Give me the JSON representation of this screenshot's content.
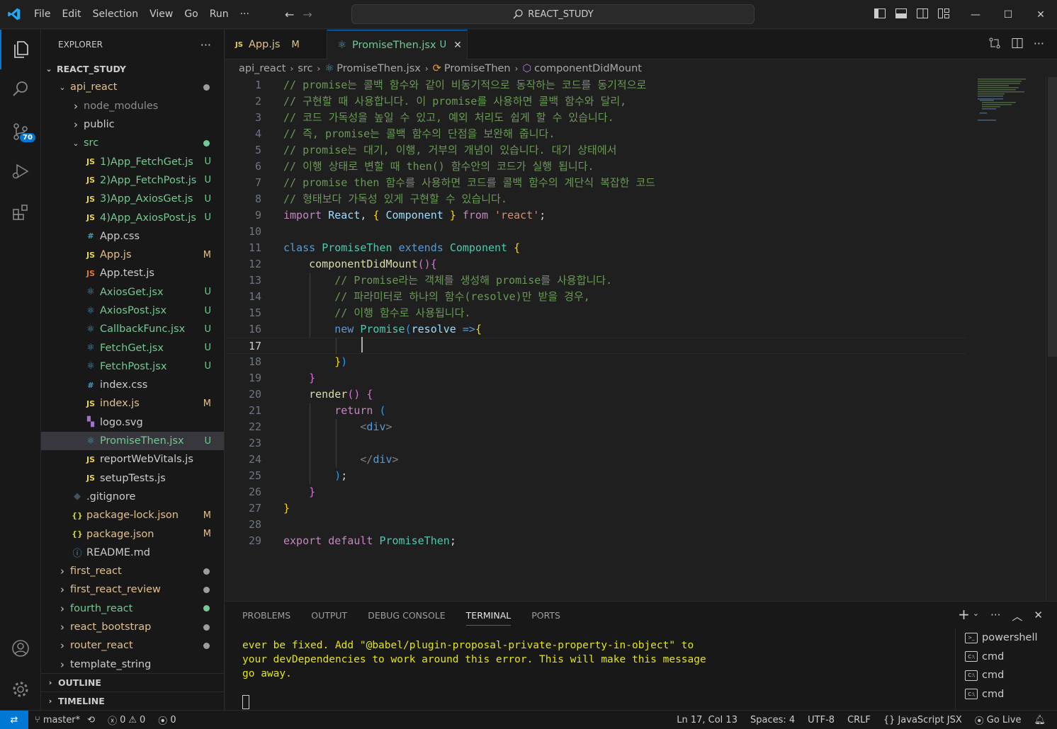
{
  "titlebar": {
    "menu": [
      "File",
      "Edit",
      "Selection",
      "View",
      "Go",
      "Run",
      "···"
    ],
    "search_text": "REACT_STUDY"
  },
  "activitybar": {
    "source_control_badge": "70"
  },
  "explorer": {
    "title": "EXPLORER",
    "more": "···",
    "root": "REACT_STUDY",
    "items": [
      {
        "label": "api_react",
        "indent": 1,
        "type": "folder-open",
        "color": "#e2c08d",
        "dot": "#9d9d9d"
      },
      {
        "label": "node_modules",
        "indent": 2,
        "type": "folder",
        "color": "#8c8c8c"
      },
      {
        "label": "public",
        "indent": 2,
        "type": "folder",
        "color": "#cccccc"
      },
      {
        "label": "src",
        "indent": 2,
        "type": "folder-open",
        "color": "#73c991",
        "dot": "#73c991"
      },
      {
        "label": "1)App_FetchGet.js",
        "indent": 3,
        "icon": "JS",
        "icon_color": "#e8d44d",
        "color": "#73c991",
        "status": "U"
      },
      {
        "label": "2)App_FetchPost.js",
        "indent": 3,
        "icon": "JS",
        "icon_color": "#e8d44d",
        "color": "#73c991",
        "status": "U"
      },
      {
        "label": "3)App_AxiosGet.js",
        "indent": 3,
        "icon": "JS",
        "icon_color": "#e8d44d",
        "color": "#73c991",
        "status": "U"
      },
      {
        "label": "4)App_AxiosPost.js",
        "indent": 3,
        "icon": "JS",
        "icon_color": "#e8d44d",
        "color": "#73c991",
        "status": "U"
      },
      {
        "label": "App.css",
        "indent": 3,
        "icon": "#",
        "icon_color": "#519aba",
        "color": "#cccccc"
      },
      {
        "label": "App.js",
        "indent": 3,
        "icon": "JS",
        "icon_color": "#e8d44d",
        "color": "#e2c08d",
        "status": "M"
      },
      {
        "label": "App.test.js",
        "indent": 3,
        "icon": "JS",
        "icon_color": "#e37933",
        "color": "#cccccc"
      },
      {
        "label": "AxiosGet.jsx",
        "indent": 3,
        "icon": "⚛",
        "icon_color": "#519aba",
        "color": "#73c991",
        "status": "U"
      },
      {
        "label": "AxiosPost.jsx",
        "indent": 3,
        "icon": "⚛",
        "icon_color": "#519aba",
        "color": "#73c991",
        "status": "U"
      },
      {
        "label": "CallbackFunc.jsx",
        "indent": 3,
        "icon": "⚛",
        "icon_color": "#519aba",
        "color": "#73c991",
        "status": "U"
      },
      {
        "label": "FetchGet.jsx",
        "indent": 3,
        "icon": "⚛",
        "icon_color": "#519aba",
        "color": "#73c991",
        "status": "U"
      },
      {
        "label": "FetchPost.jsx",
        "indent": 3,
        "icon": "⚛",
        "icon_color": "#519aba",
        "color": "#73c991",
        "status": "U"
      },
      {
        "label": "index.css",
        "indent": 3,
        "icon": "#",
        "icon_color": "#519aba",
        "color": "#cccccc"
      },
      {
        "label": "index.js",
        "indent": 3,
        "icon": "JS",
        "icon_color": "#e8d44d",
        "color": "#e2c08d",
        "status": "M"
      },
      {
        "label": "logo.svg",
        "indent": 3,
        "icon": "▚",
        "icon_color": "#a074c4",
        "color": "#cccccc"
      },
      {
        "label": "PromiseThen.jsx",
        "indent": 3,
        "icon": "⚛",
        "icon_color": "#519aba",
        "color": "#73c991",
        "status": "U",
        "selected": true
      },
      {
        "label": "reportWebVitals.js",
        "indent": 3,
        "icon": "JS",
        "icon_color": "#e8d44d",
        "color": "#cccccc"
      },
      {
        "label": "setupTests.js",
        "indent": 3,
        "icon": "JS",
        "icon_color": "#e8d44d",
        "color": "#cccccc"
      },
      {
        "label": ".gitignore",
        "indent": 2,
        "icon": "◆",
        "icon_color": "#41535b",
        "color": "#cccccc"
      },
      {
        "label": "package-lock.json",
        "indent": 2,
        "icon": "{}",
        "icon_color": "#cbcb41",
        "color": "#e2c08d",
        "status": "M"
      },
      {
        "label": "package.json",
        "indent": 2,
        "icon": "{}",
        "icon_color": "#cbcb41",
        "color": "#e2c08d",
        "status": "M"
      },
      {
        "label": "README.md",
        "indent": 2,
        "icon": "ⓘ",
        "icon_color": "#519aba",
        "color": "#cccccc"
      },
      {
        "label": "first_react",
        "indent": 1,
        "type": "folder",
        "color": "#e2c08d",
        "dot": "#9d9d9d"
      },
      {
        "label": "first_react_review",
        "indent": 1,
        "type": "folder",
        "color": "#e2c08d",
        "dot": "#9d9d9d"
      },
      {
        "label": "fourth_react",
        "indent": 1,
        "type": "folder",
        "color": "#73c991",
        "dot": "#73c991"
      },
      {
        "label": "react_bootstrap",
        "indent": 1,
        "type": "folder",
        "color": "#e2c08d",
        "dot": "#9d9d9d"
      },
      {
        "label": "router_react",
        "indent": 1,
        "type": "folder",
        "color": "#e2c08d",
        "dot": "#9d9d9d"
      },
      {
        "label": "template_string",
        "indent": 1,
        "type": "folder",
        "color": "#cccccc"
      }
    ],
    "outline": "OUTLINE",
    "timeline": "TIMELINE"
  },
  "tabs": [
    {
      "label": "App.js",
      "icon": "JS",
      "status": "M"
    },
    {
      "label": "PromiseThen.jsx",
      "icon": "⚛",
      "status": "U",
      "active": true
    }
  ],
  "breadcrumb": [
    "api_react",
    "src",
    "PromiseThen.jsx",
    "PromiseThen",
    "componentDidMount"
  ],
  "editor": {
    "current_line": 17,
    "lines": [
      [
        [
          "cm",
          "// promise는 콜백 함수와 같이 비동기적으로 동작하는 코드를 동기적으로"
        ]
      ],
      [
        [
          "cm",
          "// 구현할 때 사용합니다. 이 promise를 사용하면 콜백 함수와 달리,"
        ]
      ],
      [
        [
          "cm",
          "// 코드 가독성을 높일 수 있고, 예외 처리도 쉽게 할 수 있습니다."
        ]
      ],
      [
        [
          "cm",
          "// 즉, promise는 콜백 함수의 단점을 보완해 줍니다."
        ]
      ],
      [
        [
          "cm",
          "// promise는 대기, 이행, 거부의 개념이 있습니다. 대기 상태에서"
        ]
      ],
      [
        [
          "cm",
          "// 이행 상태로 변할 때 then() 함수안의 코드가 실행 됩니다."
        ]
      ],
      [
        [
          "cm",
          "// promise then 함수를 사용하면 코드를 콜백 함수의 계단식 복잡한 코드"
        ]
      ],
      [
        [
          "cm",
          "// 형태보다 가독성 있게 구현할 수 있습니다."
        ]
      ],
      [
        [
          "kw2",
          "import "
        ],
        [
          "var",
          "React"
        ],
        [
          "pl",
          ", "
        ],
        [
          "br1",
          "{ "
        ],
        [
          "var",
          "Component"
        ],
        [
          "br1",
          " }"
        ],
        [
          "kw2",
          " from "
        ],
        [
          "str",
          "'react'"
        ],
        [
          "pl",
          ";"
        ]
      ],
      [],
      [
        [
          "kw",
          "class "
        ],
        [
          "cls",
          "PromiseThen "
        ],
        [
          "kw",
          "extends "
        ],
        [
          "cls",
          "Component "
        ],
        [
          "br1",
          "{"
        ]
      ],
      [
        [
          "pl",
          "    "
        ],
        [
          "fn",
          "componentDidMount"
        ],
        [
          "br2",
          "(){"
        ]
      ],
      [
        [
          "pl",
          "        "
        ],
        [
          "cm",
          "// Promise라는 객체를 생성해 promise를 사용합니다."
        ]
      ],
      [
        [
          "pl",
          "        "
        ],
        [
          "cm",
          "// 파라미터로 하나의 함수(resolve)만 받을 경우,"
        ]
      ],
      [
        [
          "pl",
          "        "
        ],
        [
          "cm",
          "// 이행 함수로 사용됩니다."
        ]
      ],
      [
        [
          "pl",
          "        "
        ],
        [
          "kw",
          "new "
        ],
        [
          "cls",
          "Promise"
        ],
        [
          "br3",
          "("
        ],
        [
          "var",
          "resolve "
        ],
        [
          "kw",
          "=>"
        ],
        [
          "br1",
          "{"
        ]
      ],
      [
        [
          "pl",
          "            "
        ]
      ],
      [
        [
          "pl",
          "        "
        ],
        [
          "br1",
          "}"
        ],
        [
          "br3",
          ")"
        ]
      ],
      [
        [
          "pl",
          "    "
        ],
        [
          "br2",
          "}"
        ]
      ],
      [
        [
          "pl",
          "    "
        ],
        [
          "fn",
          "render"
        ],
        [
          "br2",
          "() {"
        ]
      ],
      [
        [
          "pl",
          "        "
        ],
        [
          "kw2",
          "return "
        ],
        [
          "br3",
          "("
        ]
      ],
      [
        [
          "pl",
          "            "
        ],
        [
          "tag",
          "<"
        ],
        [
          "kw",
          "div"
        ],
        [
          "tag",
          ">"
        ]
      ],
      [],
      [
        [
          "pl",
          "            "
        ],
        [
          "tag",
          "</"
        ],
        [
          "kw",
          "div"
        ],
        [
          "tag",
          ">"
        ]
      ],
      [
        [
          "pl",
          "        "
        ],
        [
          "br3",
          ")"
        ],
        [
          "pl",
          ";"
        ]
      ],
      [
        [
          "pl",
          "    "
        ],
        [
          "br2",
          "}"
        ]
      ],
      [
        [
          "br1",
          "}"
        ]
      ],
      [],
      [
        [
          "kw2",
          "export "
        ],
        [
          "kw2",
          "default "
        ],
        [
          "cls",
          "PromiseThen"
        ],
        [
          "pl",
          ";"
        ]
      ]
    ]
  },
  "panel": {
    "tabs": [
      "PROBLEMS",
      "OUTPUT",
      "DEBUG CONSOLE",
      "TERMINAL",
      "PORTS"
    ],
    "active_tab": "TERMINAL",
    "terminal_lines": [
      "ever be fixed. Add \"@babel/plugin-proposal-private-property-in-object\" to",
      "your devDependencies to work around this error. This will make this message",
      "go away."
    ],
    "terminals": [
      "powershell",
      "cmd",
      "cmd",
      "cmd"
    ]
  },
  "statusbar": {
    "branch": "master*",
    "errors": "0",
    "warnings": "0",
    "ports": "0",
    "position": "Ln 17, Col 13",
    "spaces": "Spaces: 4",
    "encoding": "UTF-8",
    "eol": "CRLF",
    "language": "JavaScript JSX",
    "golive": "Go Live"
  }
}
